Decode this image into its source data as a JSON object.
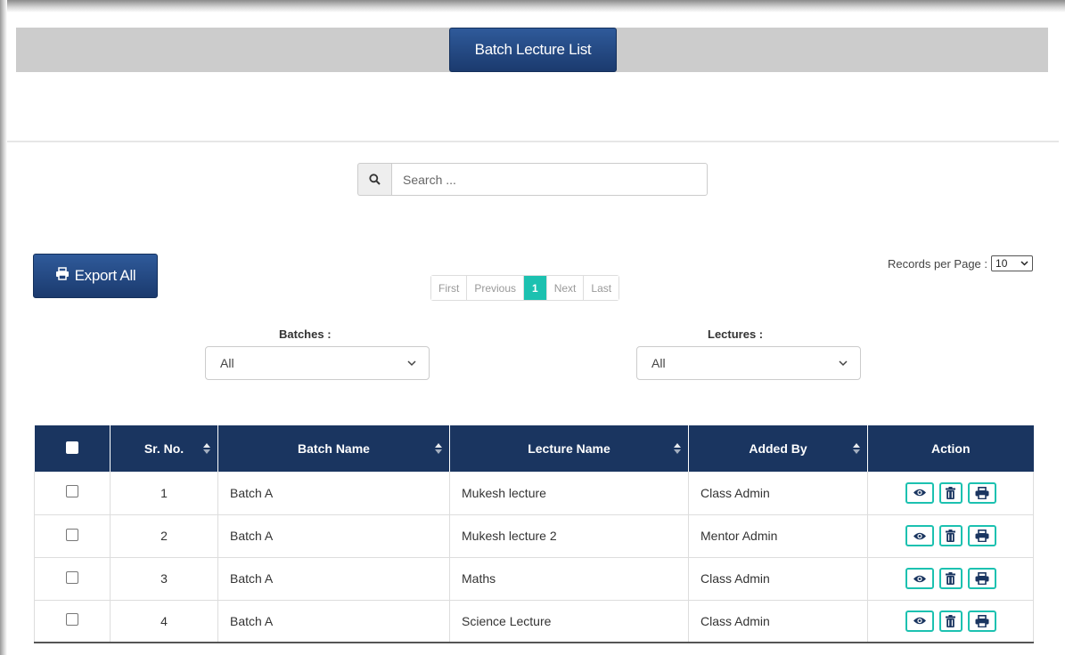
{
  "header": {
    "title": "Batch Lecture List"
  },
  "search": {
    "placeholder": "Search ...",
    "icon": "search-icon"
  },
  "toolbar": {
    "export_label": "Export All",
    "export_icon": "printer-icon"
  },
  "pagination": {
    "first": "First",
    "previous": "Previous",
    "current": "1",
    "next": "Next",
    "last": "Last"
  },
  "records_per_page": {
    "label": "Records per Page :",
    "value": "10"
  },
  "filters": {
    "batches": {
      "label": "Batches :",
      "value": "All"
    },
    "lectures": {
      "label": "Lectures :",
      "value": "All"
    }
  },
  "table": {
    "columns": [
      "Sr. No.",
      "Batch Name",
      "Lecture Name",
      "Added By",
      "Action"
    ],
    "rows": [
      {
        "sr": "1",
        "batch": "Batch A",
        "lecture": "Mukesh lecture",
        "added_by": "Class Admin"
      },
      {
        "sr": "2",
        "batch": "Batch A",
        "lecture": "Mukesh lecture 2",
        "added_by": "Mentor Admin"
      },
      {
        "sr": "3",
        "batch": "Batch A",
        "lecture": "Maths",
        "added_by": "Class Admin"
      },
      {
        "sr": "4",
        "batch": "Batch A",
        "lecture": "Science Lecture",
        "added_by": "Class Admin"
      }
    ],
    "action_icons": [
      "eye-icon",
      "trash-icon",
      "printer-icon"
    ]
  },
  "colors": {
    "primary": "#1a3560",
    "accent": "#1cc1b0",
    "title_bar": "#cccccc"
  }
}
